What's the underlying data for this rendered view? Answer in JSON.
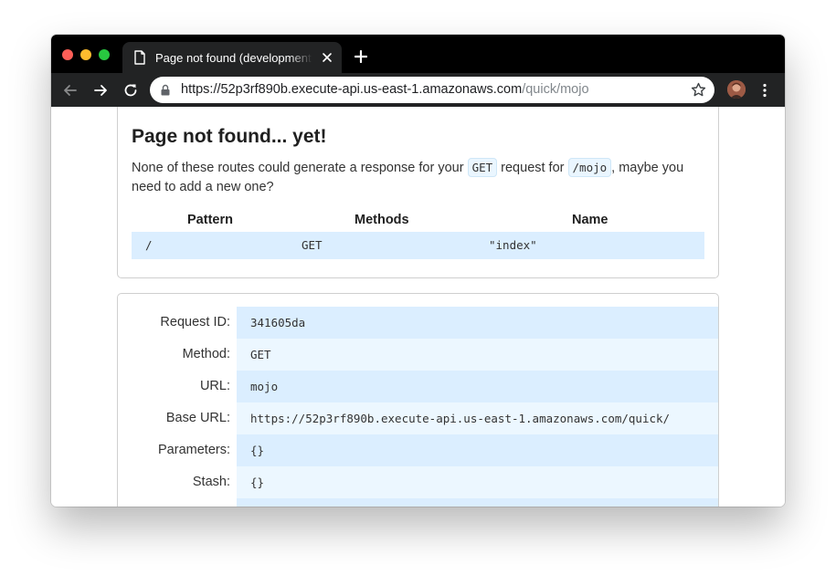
{
  "browser": {
    "tab": {
      "title": "Page not found (development mode)"
    },
    "url": {
      "host": "https://52p3rf890b.execute-api.us-east-1.amazonaws.com",
      "path": "/quick/mojo"
    }
  },
  "page": {
    "title": "Page not found... yet!",
    "message": {
      "before": "None of these routes could generate a response for your ",
      "method": "GET",
      "middle": " request for ",
      "path": "/mojo",
      "after": ", maybe you need to add a new one?"
    },
    "routes": {
      "headers": {
        "pattern": "Pattern",
        "methods": "Methods",
        "name": "Name"
      },
      "rows": [
        {
          "pattern": "/",
          "methods": "GET",
          "name": "\"index\""
        }
      ]
    },
    "request_info": [
      {
        "label": "Request ID:",
        "value": "341605da"
      },
      {
        "label": "Method:",
        "value": "GET"
      },
      {
        "label": "URL:",
        "value": "mojo"
      },
      {
        "label": "Base URL:",
        "value": "https://52p3rf890b.execute-api.us-east-1.amazonaws.com/quick/"
      },
      {
        "label": "Parameters:",
        "value": "{}"
      },
      {
        "label": "Stash:",
        "value": "{}"
      },
      {
        "label": "",
        "value": ""
      }
    ]
  }
}
